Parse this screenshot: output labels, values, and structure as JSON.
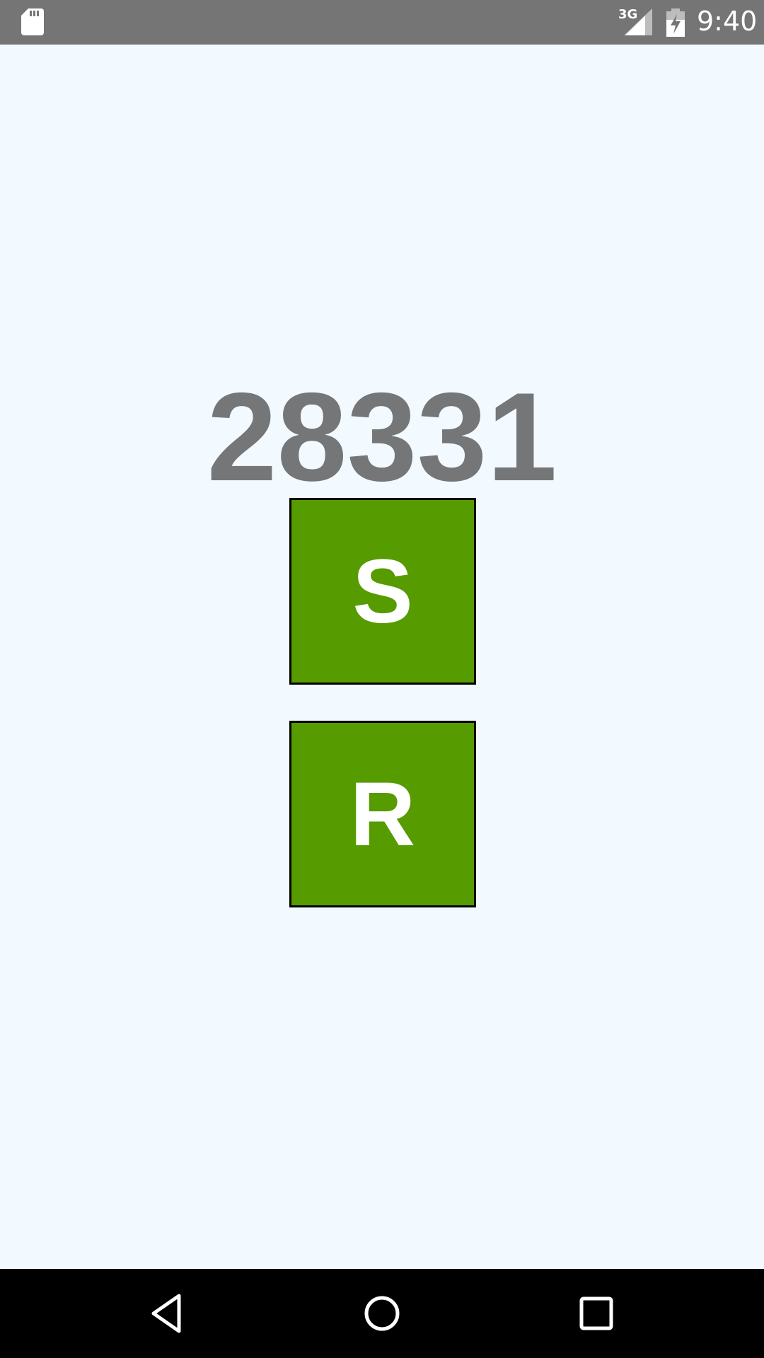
{
  "status_bar": {
    "network": "3G",
    "time": "9:40",
    "icons": [
      "sd-card-icon",
      "signal-icon",
      "battery-charging-icon"
    ]
  },
  "main": {
    "counter": "28331",
    "buttons": [
      {
        "label": "S"
      },
      {
        "label": "R"
      }
    ]
  },
  "nav_bar": {
    "icons": [
      "back-icon",
      "home-icon",
      "recents-icon"
    ]
  },
  "colors": {
    "background": "#f2faff",
    "status_bar": "#757575",
    "counter_text": "#747677",
    "button_fill": "#569b00",
    "button_border": "#000000",
    "nav_bar": "#000000"
  }
}
